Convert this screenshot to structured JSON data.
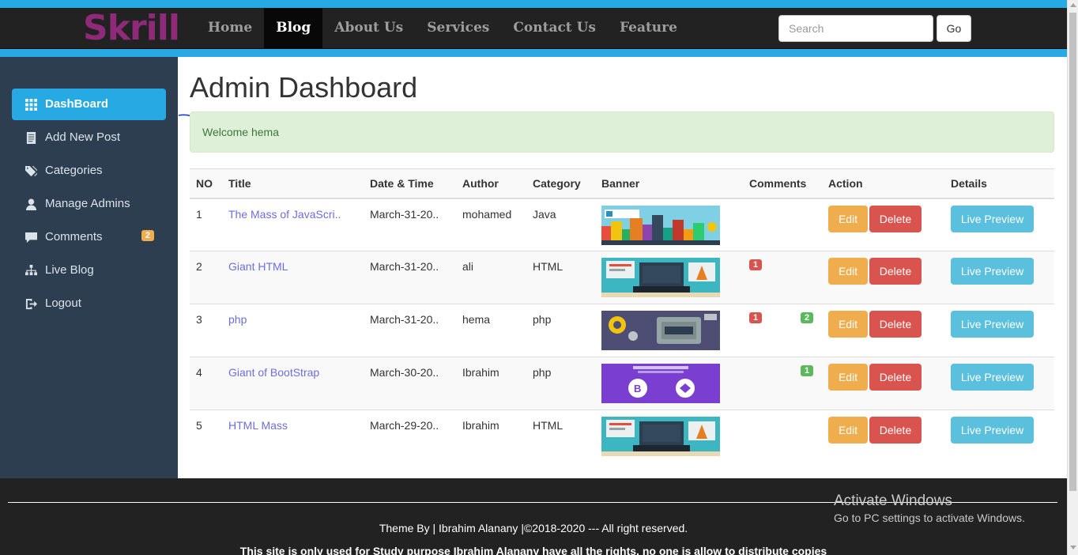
{
  "brand": "Skrill",
  "colors": {
    "accent": "#27a9e3",
    "navbar": "#222222",
    "sidebar": "#2c3e50",
    "brand": "#8e2a78"
  },
  "nav": {
    "items": [
      {
        "label": "Home"
      },
      {
        "label": "Blog",
        "active": true
      },
      {
        "label": "About Us"
      },
      {
        "label": "Services"
      },
      {
        "label": "Contact Us"
      },
      {
        "label": "Feature"
      }
    ],
    "search_placeholder": "Search",
    "go_label": "Go"
  },
  "sidebar": {
    "items": [
      {
        "label": "DashBoard",
        "icon": "dashboard-grid-icon",
        "active": true
      },
      {
        "label": "Add New Post",
        "icon": "document-icon"
      },
      {
        "label": "Categories",
        "icon": "tags-icon"
      },
      {
        "label": "Manage Admins",
        "icon": "user-icon"
      },
      {
        "label": "Comments",
        "icon": "comment-icon",
        "badge": "2"
      },
      {
        "label": "Live Blog",
        "icon": "sitemap-icon"
      },
      {
        "label": "Logout",
        "icon": "logout-icon"
      }
    ]
  },
  "main": {
    "title": "Admin Dashboard",
    "welcome": "Welcome hema",
    "table": {
      "headers": [
        "NO",
        "Title",
        "Date & Time",
        "Author",
        "Category",
        "Banner",
        "Comments",
        "Action",
        "Details"
      ],
      "rows": [
        {
          "no": "1",
          "title": "The Mass of JavaScri..",
          "date": "March-31-20..",
          "author": "mohamed",
          "category": "Java",
          "banner": "javascript",
          "comments_red": "",
          "comments_green": ""
        },
        {
          "no": "2",
          "title": "Giant HTML",
          "date": "March-31-20..",
          "author": "ali",
          "category": "HTML",
          "banner": "html",
          "comments_red": "1",
          "comments_green": ""
        },
        {
          "no": "3",
          "title": "php",
          "date": "March-31-20..",
          "author": "hema",
          "category": "php",
          "banner": "php",
          "comments_red": "1",
          "comments_green": "2"
        },
        {
          "no": "4",
          "title": "Giant of BootStrap",
          "date": "March-30-20..",
          "author": "Ibrahim",
          "category": "php",
          "banner": "bootstrap",
          "comments_red": "",
          "comments_green": "1"
        },
        {
          "no": "5",
          "title": "HTML Mass",
          "date": "March-29-20..",
          "author": "Ibrahim",
          "category": "HTML",
          "banner": "html",
          "comments_red": "",
          "comments_green": ""
        }
      ],
      "edit_label": "Edit",
      "delete_label": "Delete",
      "preview_label": "Live Preview"
    }
  },
  "footer": {
    "credit": "Theme By | Ibrahim Alanany |©2018-2020 --- All right reserved.",
    "note": "This site is only used for Study purpose Ibrahim Alanany have all the rights. no one is allow to distribute copies"
  },
  "watermark": {
    "title": "Activate Windows",
    "subtitle": "Go to PC settings to activate Windows."
  }
}
